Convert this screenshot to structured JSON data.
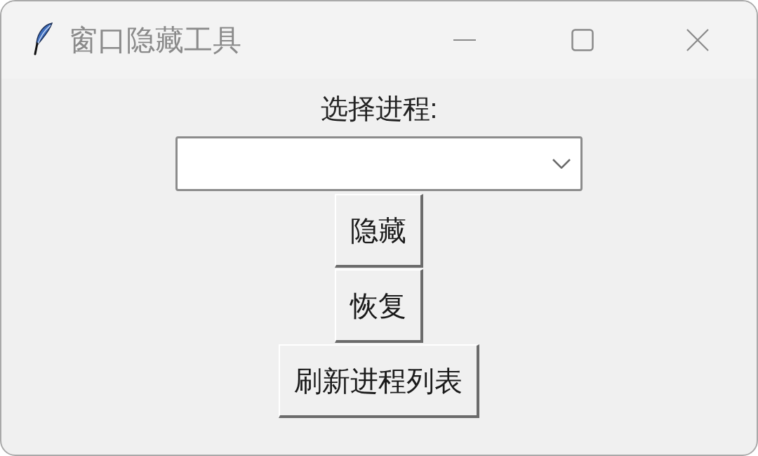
{
  "window": {
    "title": "窗口隐藏工具"
  },
  "process_label": "选择进程:",
  "process_select": {
    "disabled": false
  },
  "buttons": [
    {
      "label": "隐藏"
    },
    {
      "label": "恢复"
    },
    {
      "label": "刷新进程列表"
    }
  ]
}
